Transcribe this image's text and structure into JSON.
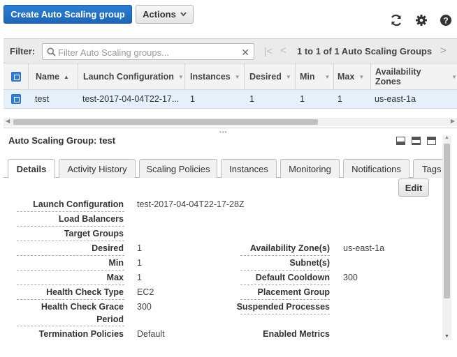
{
  "toolbar": {
    "create_label": "Create Auto Scaling group",
    "actions_label": "Actions",
    "refresh_icon": "refresh-icon",
    "settings_icon": "gear-icon",
    "help_icon": "help-icon"
  },
  "filter": {
    "label": "Filter:",
    "placeholder": "Filter Auto Scaling groups...",
    "pager_text": "1 to 1 of 1 Auto Scaling Groups"
  },
  "table": {
    "columns": [
      "Name",
      "Launch Configuration",
      "Instances",
      "Desired",
      "Min",
      "Max",
      "Availability Zones"
    ],
    "rows": [
      {
        "name": "test",
        "launch_config": "test-2017-04-04T22-17...",
        "instances": "1",
        "desired": "1",
        "min": "1",
        "max": "1",
        "az": "us-east-1a"
      }
    ]
  },
  "detail": {
    "title": "Auto Scaling Group: test",
    "tabs": [
      "Details",
      "Activity History",
      "Scaling Policies",
      "Instances",
      "Monitoring",
      "Notifications",
      "Tags"
    ],
    "active_tab": "Details",
    "edit_label": "Edit",
    "left": [
      {
        "label": "Launch Configuration",
        "value": "test-2017-04-04T22-17-28Z"
      },
      {
        "label": "Load Balancers",
        "value": ""
      },
      {
        "label": "Target Groups",
        "value": ""
      },
      {
        "label": "Desired",
        "value": "1"
      },
      {
        "label": "Min",
        "value": "1"
      },
      {
        "label": "Max",
        "value": "1"
      },
      {
        "label": "Health Check Type",
        "value": "EC2"
      },
      {
        "label": "Health Check Grace",
        "label2": "Period",
        "value": "300"
      },
      {
        "label": "Termination Policies",
        "value": "Default"
      }
    ],
    "right": [
      {
        "label": "Availability Zone(s)",
        "value": "us-east-1a"
      },
      {
        "label": "Subnet(s)",
        "value": ""
      },
      {
        "label": "Default Cooldown",
        "value": "300"
      },
      {
        "label": "Placement Group",
        "value": ""
      },
      {
        "label": "Suspended Processes",
        "value": ""
      },
      {
        "label": "Enabled Metrics",
        "value": ""
      }
    ]
  },
  "colors": {
    "primary": "#1d66b7",
    "selected_row": "#e6f0fa"
  }
}
